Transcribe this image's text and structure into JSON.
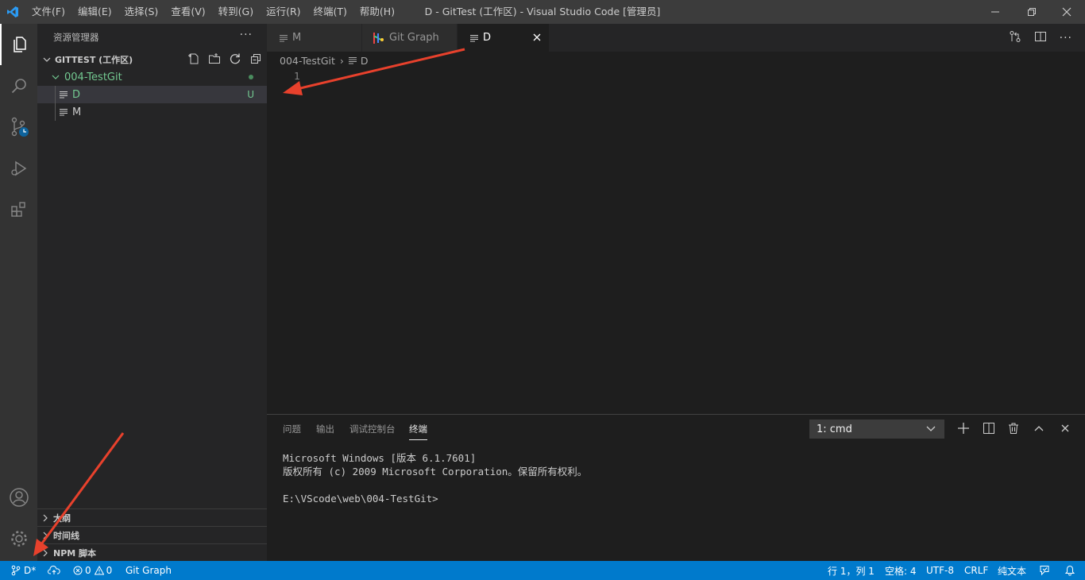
{
  "titlebar": {
    "menus": [
      "文件(F)",
      "编辑(E)",
      "选择(S)",
      "查看(V)",
      "转到(G)",
      "运行(R)",
      "终端(T)",
      "帮助(H)"
    ],
    "title": "D - GitTest (工作区) - Visual Studio Code [管理员]"
  },
  "activitybar": {
    "icons": [
      "explorer-icon",
      "search-icon",
      "source-control-icon",
      "run-debug-icon",
      "extensions-icon",
      "account-icon",
      "manage-gear-icon"
    ]
  },
  "sidebar": {
    "header": "资源管理器",
    "more": "···",
    "workspace": "GITTEST (工作区)",
    "folder": "004-TestGit",
    "files": [
      {
        "name": "D",
        "badge": "U"
      },
      {
        "name": "M",
        "badge": ""
      }
    ],
    "sections": [
      "大纲",
      "时间线",
      "NPM 脚本"
    ]
  },
  "tabs": [
    {
      "label": "M"
    },
    {
      "label": "Git Graph"
    },
    {
      "label": "D"
    }
  ],
  "breadcrumb": {
    "folder": "004-TestGit",
    "sep": "›",
    "file": "D"
  },
  "editor": {
    "line_number": "1"
  },
  "panel": {
    "tabs": [
      "问题",
      "输出",
      "调试控制台",
      "终端"
    ],
    "terminal_select": "1: cmd",
    "terminal_lines": [
      "Microsoft Windows [版本 6.1.7601]",
      "版权所有 (c) 2009 Microsoft Corporation。保留所有权利。",
      "",
      "E:\\VScode\\web\\004-TestGit>"
    ]
  },
  "statusbar": {
    "branch": "D*",
    "errors": "0",
    "warnings": "0",
    "git_graph": "Git Graph",
    "position": "行 1，列 1",
    "spaces": "空格: 4",
    "encoding": "UTF-8",
    "eol": "CRLF",
    "language": "纯文本"
  },
  "colors": {
    "statusbar": "#007acc",
    "untracked": "#73c991",
    "annotation_arrow": "#e8412c"
  }
}
